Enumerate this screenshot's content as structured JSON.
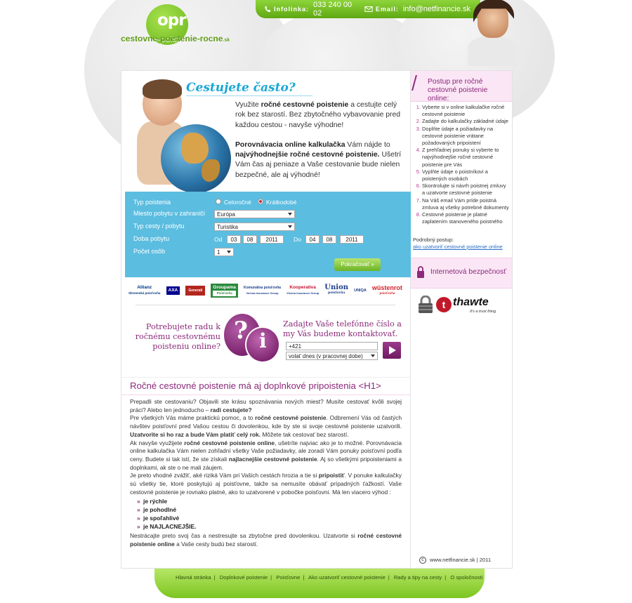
{
  "header": {
    "logo_text": "opr",
    "logo_domain": "cestovne-poistenie-rocne",
    "logo_tld": ".sk",
    "phone_label": "Infolinka:",
    "phone": "033 240 00 02",
    "email_label": "Email:",
    "email": "info@netfinancie.sk"
  },
  "hero": {
    "title": "Cestujete často?",
    "p1_a": "Využite ",
    "p1_b": "ročné cestovné poistenie",
    "p1_c": " a cestujte celý rok bez starostí. Bez zbytočného vybavovanie pred každou cestou - navyše výhodne!",
    "p2_a": "Porovnávacia online kalkulačka",
    "p2_b": " Vám nájde to ",
    "p2_c": "najvýhodnejšie ročné cestovné poistenie.",
    "p2_d": " Ušetrí Vám čas aj peniaze a Vaše cestovanie bude nielen bezpečné, ale aj výhodné!"
  },
  "calculator": {
    "type_label": "Typ poistenia",
    "opt_annual": "Celoročné",
    "opt_short": "Krátkodobé",
    "residence_label": "Miesto pobytu v zahraničí",
    "residence_value": "Európa",
    "trip_label": "Typ cesty / pobytu",
    "trip_value": "Turistika",
    "period_label": "Doba pobytu",
    "from_label": "Od",
    "from_day": "03",
    "from_month": "08",
    "from_year": "2011",
    "to_label": "Do",
    "to_day": "04",
    "to_month": "08",
    "to_year": "2011",
    "persons_label": "Počet osôb",
    "persons_value": "1",
    "continue": "Pokračovať »"
  },
  "partners": [
    "Allianz",
    "AXA",
    "Generali",
    "Groupama",
    "Komunálna poisťovňa",
    "Kooperativa",
    "Union",
    "UNIQA",
    "wüstenrot"
  ],
  "partner_subs": [
    "Slovenská poisťovňa",
    "",
    "",
    "Poisťovňa",
    "Vienna Insurance Group",
    "Vienna Insurance Group",
    "poisťovňa",
    "",
    "poisťovňa"
  ],
  "callback": {
    "question": "Potrebujete radu k ročnému cestovnému poisteniu online?",
    "prompt": "Zadajte Vaše telefónne číslo a my Vás budeme kontaktovať.",
    "phone_value": "+421",
    "time_value": "volať dnes (v pracovnej dobe)"
  },
  "article": {
    "h1": "Ročné cestovné poistenie má aj doplnkové pripoistenia <H1>",
    "p1": "Prepadli ste cestovaniu? Objavili ste krásu spoznávania nových miest? Musíte cestovať kvôli svojej práci? Alebo len jednoducho – ",
    "p1_b": "radi cestujete?",
    "p2a": "Pre všetkých Vás máme praktickú pomoc, a to ",
    "p2b": "ročné cestovné poistenie",
    "p2c": ". Odbremení Vás od častých návštev poisťovní pred Vašou cestou či dovolenkou, kde by ste si svoje cestovné poistenie uzatvorili. ",
    "p2d": "Uzatvorite si ho raz a bude Vám platiť celý rok.",
    "p2e": " Môžete tak cestovať bez starostí.",
    "p3a": "Ak navyše využijete ",
    "p3b": "ročné cestovné poistenie online",
    "p3c": ", ušetríte najviac ako je to možné. Porovnávacia online kalkulačka Vám nielen zohľadní všetky Vaše požiadavky, ale zoradí Vám ponuky poisťovní podľa ceny. Budete si tak istí, že ste získali ",
    "p3d": "najlacnejšie cestovné poistenie",
    "p3e": ". Aj so všetkými pripoisteniami a doplnkami, ak ste o ne mali záujem.",
    "p4a": "Je preto vhodné zvážiť, aké riziká Vám pri Vašich cestách hrozia a tie si ",
    "p4b": "pripoistiť",
    "p4c": ". V ponuke kalkulačky sú všetky tie, ktoré poskytujú aj poisťovne, takže sa nemusíte obávať prípadných ťažkostí. Vaše cestovné poistenie je rovnako platné, ako to uzatvorené v pobočke poisťovni. Má len viacero výhod :",
    "bullets": [
      "je rýchle",
      "je pohodlné",
      "je spoľahlivé",
      "je NAJLACNEJŠIE."
    ],
    "p5a": "Nestrácajte preto svoj čas a nestresujte sa zbytočne pred dovolenkou. Uzatvorte si ",
    "p5b": "ročné cestovné poistenie online",
    "p5c": " a Vaše cesty budú bez starostí."
  },
  "sidebar": {
    "title": "Postup pre ročné cestovné poistenie online:",
    "steps": [
      "Vyberte si v online kalkulačke ročné cestovné poistenie",
      "Zadajte do kalkulačky základné údaje",
      "Doplňte údaje a požiadavky na cestovné poistenie vrátane požadovaných pripoistení",
      "Z prehľadnej ponuky si vyberte to najvýhodnejšie ročné cestovné poistenie pre Vás",
      "Vyplňte údaje o poistníkovi a poistených osobách",
      "Skontrolujte si návrh poistnej zmluvy a uzatvorte cestovné poistenie",
      "Na Váš email Vám príde poistná zmluva aj všetky potrebné dokumenty",
      "Cestovné poistenie je platné zaplatením stanoveného poistného"
    ],
    "detail_label": "Podrobný postup:",
    "detail_link": "ako uzatvoriť cestovné poistenie online",
    "security_title": "Internetová bezpečnosť",
    "thawte_name": "thawte",
    "thawte_tag": "It's a trust thing",
    "copyright": "www.netfinancie.sk | 2011"
  },
  "footer": {
    "links": [
      "Hlavná stránka",
      "Doplnkové poistenie",
      "Poisťovne",
      "Ako uzatvoriť cestovné poistenie",
      "Rady a tipy na cesty",
      "O spoločnosti"
    ]
  },
  "colors": {
    "accent_green": "#7cc520",
    "accent_purple": "#8b2a7a",
    "calc_blue": "#5bbde0",
    "title_blue": "#1aa7d6"
  }
}
